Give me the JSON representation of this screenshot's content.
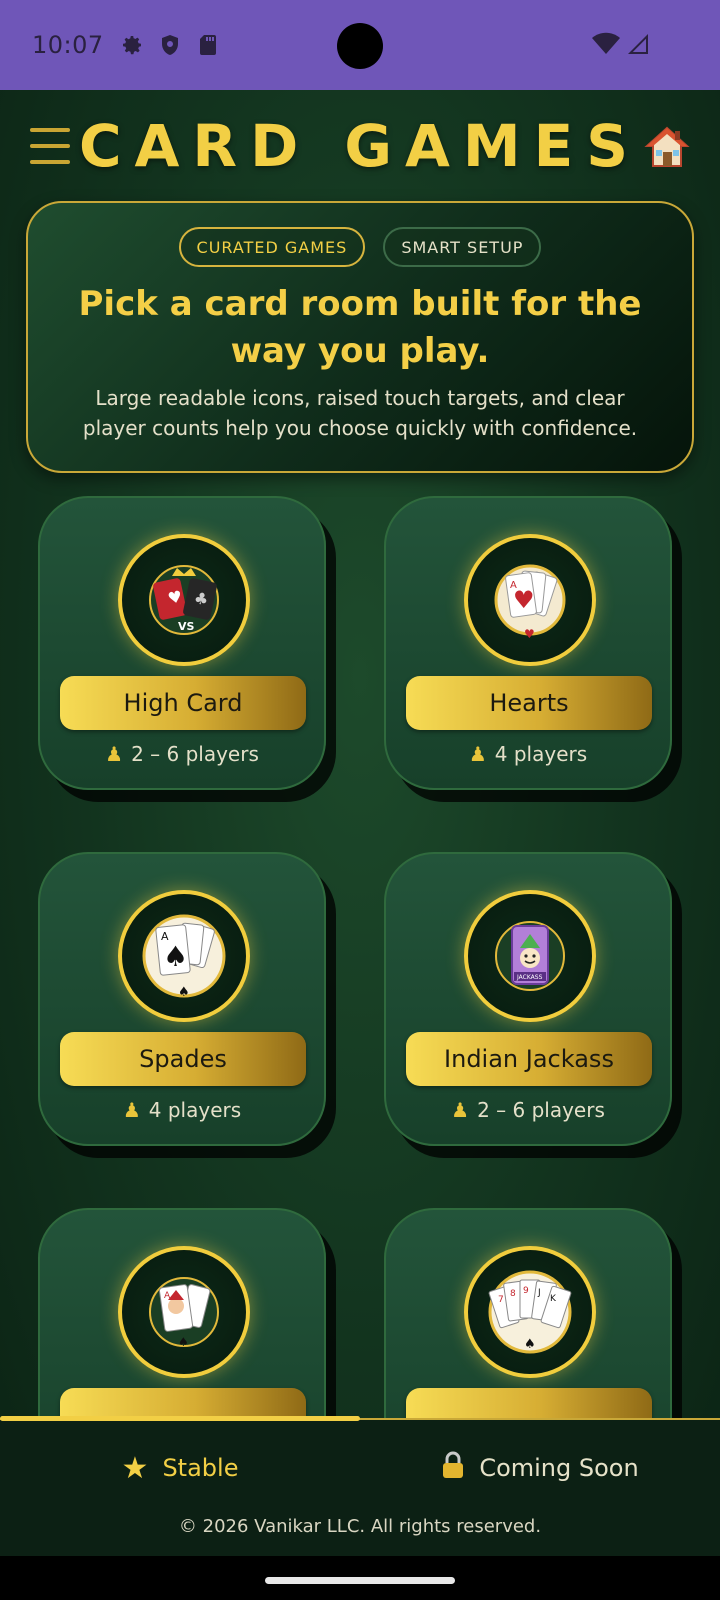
{
  "status_bar": {
    "time": "10:07",
    "left_icons": [
      "settings-icon",
      "shield-icon",
      "sd-card-icon"
    ],
    "right_icons": [
      "wifi-icon",
      "cellular-signal-icon"
    ]
  },
  "header": {
    "title": "CARD GAMES",
    "menu_icon": "hamburger-menu-icon",
    "home_icon": "home-icon"
  },
  "hero": {
    "chips": [
      "CURATED GAMES",
      "SMART SETUP"
    ],
    "title": "Pick a card room built for the way you play.",
    "subtitle": "Large readable icons, raised touch targets, and clear player counts help you choose quickly with confidence."
  },
  "games": [
    {
      "name": "High Card",
      "players": "2 – 6 players",
      "icon": "high-card-icon"
    },
    {
      "name": "Hearts",
      "players": "4 players",
      "icon": "hearts-icon"
    },
    {
      "name": "Spades",
      "players": "4 players",
      "icon": "spades-icon"
    },
    {
      "name": "Indian Jackass",
      "players": "2 – 6 players",
      "icon": "jackass-icon"
    },
    {
      "name": "",
      "players": "",
      "icon": "joker-cards-icon"
    },
    {
      "name": "",
      "players": "",
      "icon": "fan-cards-icon"
    }
  ],
  "bottom_tabs": {
    "stable": {
      "label": "Stable",
      "icon": "star-icon",
      "selected": true
    },
    "coming": {
      "label": "Coming Soon",
      "icon": "lock-icon",
      "selected": false
    }
  },
  "footer": {
    "copyright": "© 2026 Vanikar LLC. All rights reserved."
  },
  "colors": {
    "accent_gold": "#f2cf45",
    "status_bar": "#6f56b8",
    "background_green": "#12331e"
  }
}
